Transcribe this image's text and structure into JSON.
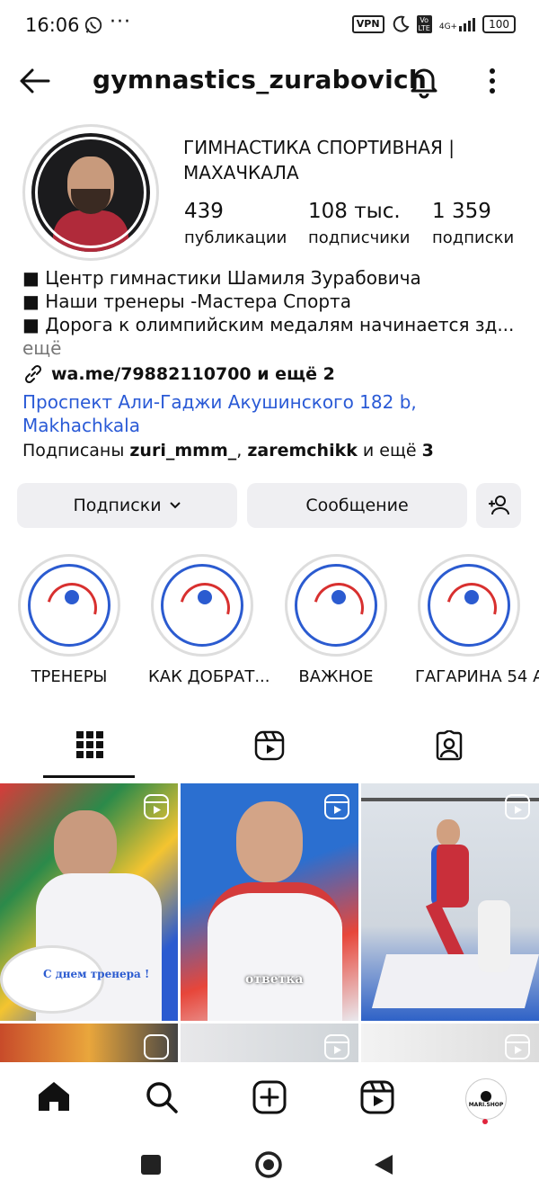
{
  "status_bar": {
    "time": "16:06",
    "dots": "···",
    "vpn": "VPN",
    "lte_top": "Vo",
    "lte_bottom": "LTE",
    "network": "4G+",
    "battery": "100"
  },
  "header": {
    "username": "gymnastics_zurabovich"
  },
  "profile": {
    "name": "ГИМНАСТИКА СПОРТИВНАЯ | МАХАЧКАЛА",
    "stats": [
      {
        "value": "439",
        "label": "публикации"
      },
      {
        "value": "108 тыс.",
        "label": "подписчики"
      },
      {
        "value": "1 359",
        "label": "подписки"
      }
    ],
    "bio_lines": [
      "■ Центр гимнастики Шамиля Зурабовича",
      "■ Наши тренеры -Мастера Спорта",
      "■ Дорога к олимпийским медалям начинается зд..."
    ],
    "bio_more": "ещё",
    "link": "wa.me/79882110700 и ещё 2",
    "address": "Проспект Али-Гаджи Акушинского 182 b, Makhachkala",
    "followed_prefix": "Подписаны ",
    "followed_user1": "zuri_mmm_",
    "followed_sep": ", ",
    "followed_user2": "zaremchikk",
    "followed_mid": " и ещё ",
    "followed_count": "3"
  },
  "actions": {
    "subscriptions": "Подписки",
    "message": "Сообщение"
  },
  "highlights": [
    {
      "label": "ТРЕНЕРЫ"
    },
    {
      "label": "КАК ДОБРАТ..."
    },
    {
      "label": "ВАЖНОЕ"
    },
    {
      "label": "ГАГАРИНА 54 А"
    }
  ],
  "posts": [
    {
      "caption": "С днем тренера !"
    },
    {
      "caption": "ответка"
    },
    {
      "caption": ""
    }
  ],
  "bottom_nav": {
    "profile_label": "MARI.SHOP"
  },
  "colors": {
    "link_blue": "#2a5ad6",
    "button_bg": "#efeff2",
    "notification_dot": "#e0243c"
  }
}
